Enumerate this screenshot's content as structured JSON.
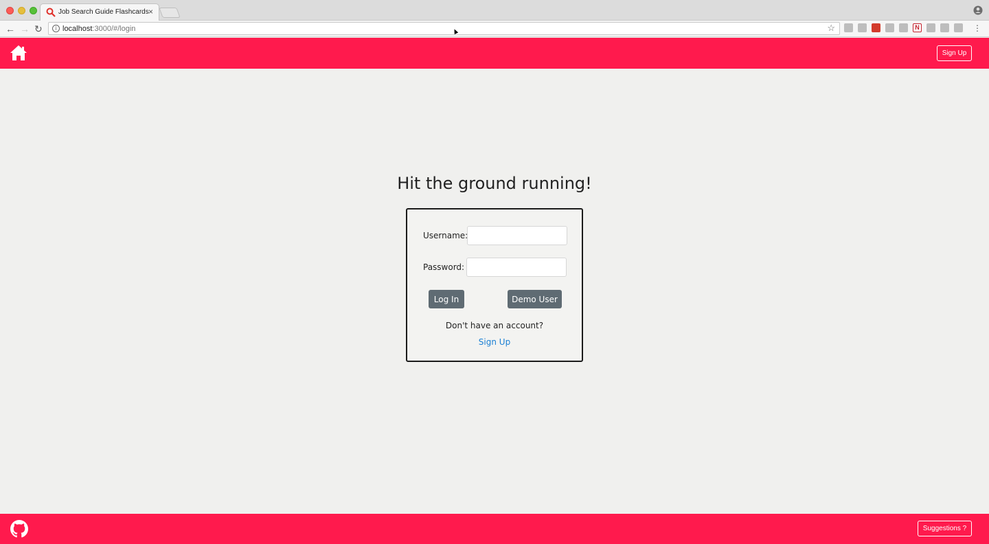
{
  "browser": {
    "tab_title": "Job Search Guide Flashcards",
    "tab_close": "×",
    "url_host": "localhost",
    "url_path": ":3000/#/login",
    "icons": [
      "search-favicon",
      "back-arrow-icon",
      "forward-arrow-icon",
      "reload-icon",
      "info-icon",
      "star-icon",
      "menu-icon",
      "profile-icon"
    ]
  },
  "header": {
    "home_icon": "home-icon",
    "signup_label": "Sign Up"
  },
  "main": {
    "heading": "Hit the ground running!",
    "username_label": "Username:",
    "password_label": "Password:",
    "username_value": "",
    "password_value": "",
    "login_label": "Log In",
    "demo_label": "Demo User",
    "no_account_text": "Don't have an account?",
    "signup_link": "Sign Up"
  },
  "footer": {
    "github_icon": "github-icon",
    "suggestions_label": "Suggestions ?"
  },
  "colors": {
    "brand": "#ff1a4d",
    "button": "#5f6b73",
    "link": "#1a7fd4",
    "background": "#f0f0ee"
  }
}
